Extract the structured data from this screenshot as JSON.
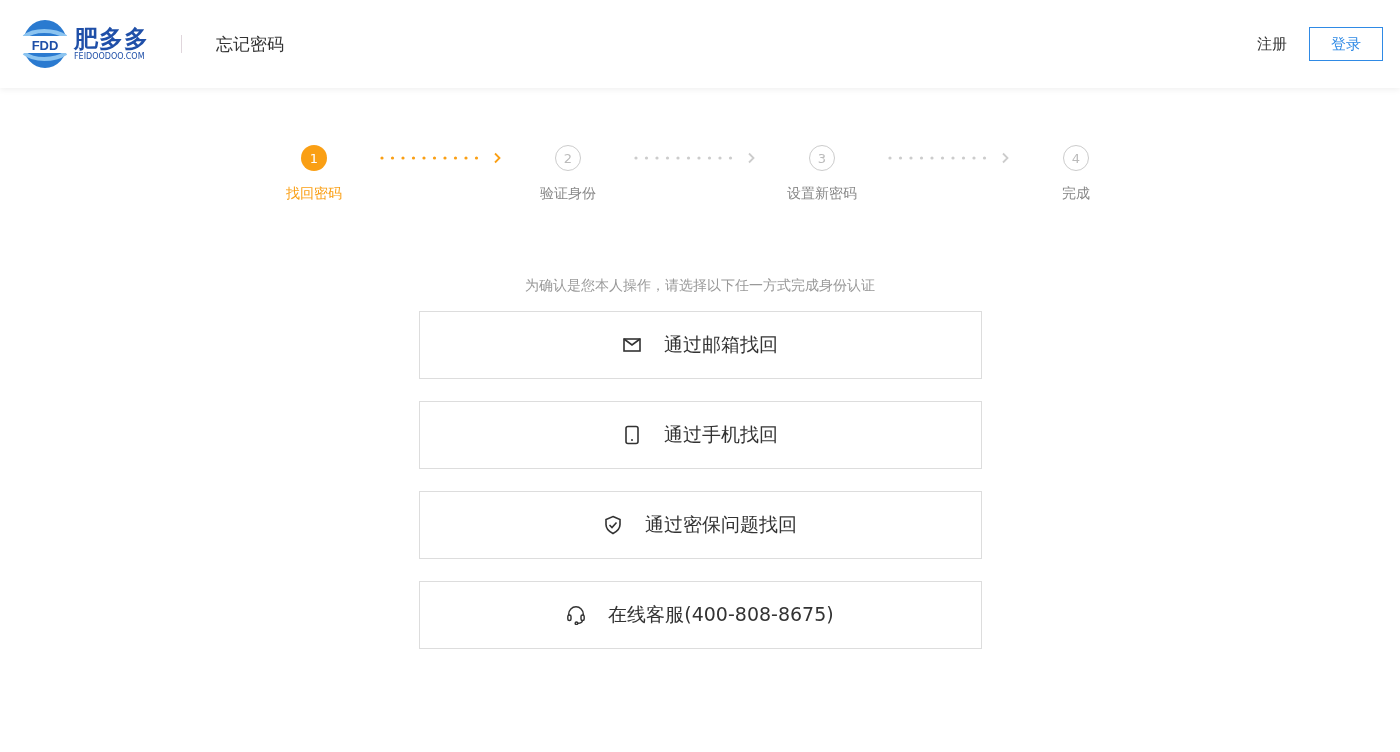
{
  "header": {
    "logo": {
      "mark": "FDD",
      "name": "肥多多",
      "domain": "FEIDOODOO.COM"
    },
    "title": "忘记密码",
    "register": "注册",
    "login": "登录"
  },
  "steps": [
    {
      "number": "1",
      "label": "找回密码",
      "selected": true
    },
    {
      "number": "2",
      "label": "验证身份",
      "selected": false
    },
    {
      "number": "3",
      "label": "设置新密码",
      "selected": false
    },
    {
      "number": "4",
      "label": "完成",
      "selected": false
    }
  ],
  "connectors": [
    {
      "active": true
    },
    {
      "active": false
    },
    {
      "active": false
    }
  ],
  "prompt": "为确认是您本人操作，请选择以下任一方式完成身份认证",
  "options": [
    {
      "kind": "email",
      "label": "通过邮箱找回"
    },
    {
      "kind": "phone",
      "label": "通过手机找回"
    },
    {
      "kind": "security",
      "label": "通过密保问题找回"
    },
    {
      "kind": "support",
      "label": "在线客服(400-808-8675)"
    }
  ]
}
